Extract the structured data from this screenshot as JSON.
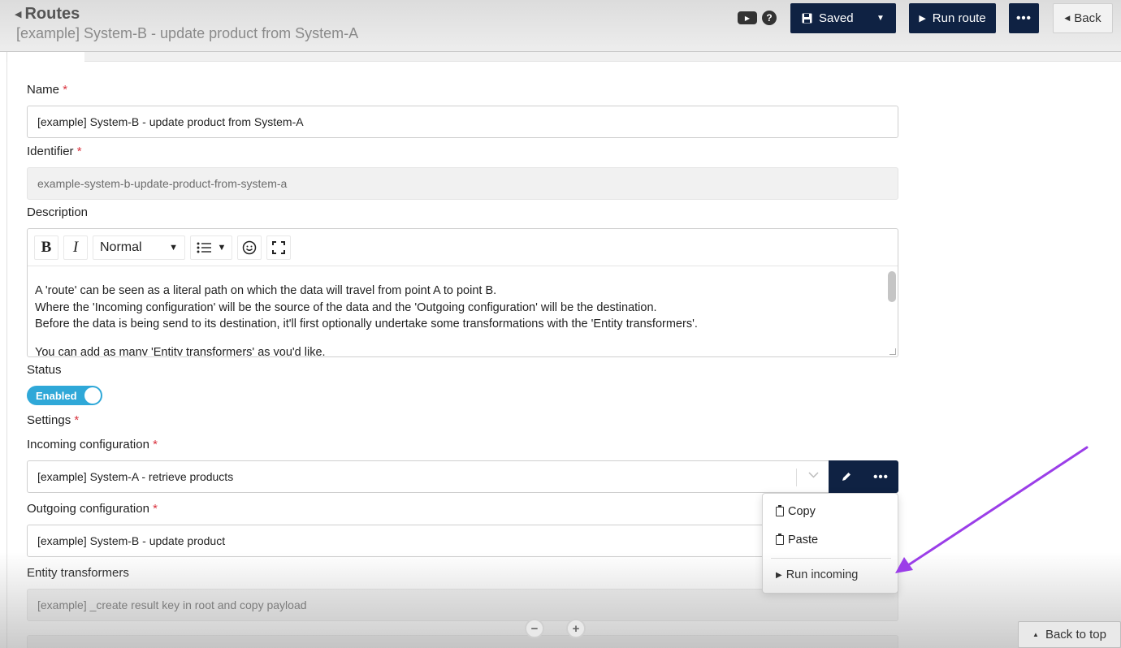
{
  "header": {
    "back_label": "Routes",
    "subtitle": "[example] System-B - update product from System-A",
    "saved_label": "Saved",
    "run_route_label": "Run route",
    "back_button_label": "Back"
  },
  "form": {
    "name_label": "Name",
    "name_value": "[example] System-B - update product from System-A",
    "identifier_label": "Identifier",
    "identifier_value": "example-system-b-update-product-from-system-a",
    "description_label": "Description",
    "editor": {
      "format_value": "Normal",
      "lines": [
        "A 'route' can be seen as a literal path on which the data will travel from point A to point B.",
        "Where the 'Incoming configuration' will be the source of the data and the 'Outgoing configuration' will be the destination.",
        "Before the data is being send to its destination, it'll first optionally undertake some transformations with the 'Entity transformers'.",
        "You can add as many 'Entity transformers' as you'd like."
      ]
    },
    "status_label": "Status",
    "status_value": "Enabled",
    "settings_label": "Settings",
    "incoming_label": "Incoming configuration",
    "incoming_value": "[example] System-A - retrieve products",
    "outgoing_label": "Outgoing configuration",
    "outgoing_value": "[example] System-B - update product",
    "transformers_label": "Entity transformers",
    "transformer_1": "[example] _create result key in root and copy payload"
  },
  "menu": {
    "copy_label": "Copy",
    "paste_label": "Paste",
    "run_incoming_label": "Run incoming"
  },
  "footer": {
    "back_to_top_label": "Back to top"
  },
  "colors": {
    "primary_dark": "#0f2243",
    "toggle_on": "#2fa8d8",
    "annotation_arrow": "#9b3ee8",
    "required": "#d9333f"
  }
}
